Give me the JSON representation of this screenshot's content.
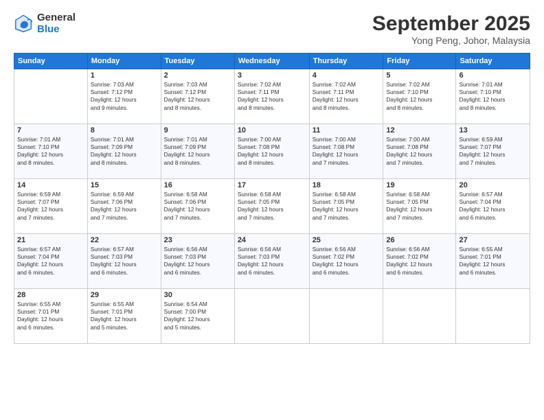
{
  "logo": {
    "general": "General",
    "blue": "Blue"
  },
  "title": "September 2025",
  "subtitle": "Yong Peng, Johor, Malaysia",
  "days_header": [
    "Sunday",
    "Monday",
    "Tuesday",
    "Wednesday",
    "Thursday",
    "Friday",
    "Saturday"
  ],
  "weeks": [
    [
      {
        "day": "",
        "info": ""
      },
      {
        "day": "1",
        "info": "Sunrise: 7:03 AM\nSunset: 7:12 PM\nDaylight: 12 hours\nand 9 minutes."
      },
      {
        "day": "2",
        "info": "Sunrise: 7:03 AM\nSunset: 7:12 PM\nDaylight: 12 hours\nand 8 minutes."
      },
      {
        "day": "3",
        "info": "Sunrise: 7:02 AM\nSunset: 7:11 PM\nDaylight: 12 hours\nand 8 minutes."
      },
      {
        "day": "4",
        "info": "Sunrise: 7:02 AM\nSunset: 7:11 PM\nDaylight: 12 hours\nand 8 minutes."
      },
      {
        "day": "5",
        "info": "Sunrise: 7:02 AM\nSunset: 7:10 PM\nDaylight: 12 hours\nand 8 minutes."
      },
      {
        "day": "6",
        "info": "Sunrise: 7:01 AM\nSunset: 7:10 PM\nDaylight: 12 hours\nand 8 minutes."
      }
    ],
    [
      {
        "day": "7",
        "info": "Sunrise: 7:01 AM\nSunset: 7:10 PM\nDaylight: 12 hours\nand 8 minutes."
      },
      {
        "day": "8",
        "info": "Sunrise: 7:01 AM\nSunset: 7:09 PM\nDaylight: 12 hours\nand 8 minutes."
      },
      {
        "day": "9",
        "info": "Sunrise: 7:01 AM\nSunset: 7:09 PM\nDaylight: 12 hours\nand 8 minutes."
      },
      {
        "day": "10",
        "info": "Sunrise: 7:00 AM\nSunset: 7:08 PM\nDaylight: 12 hours\nand 8 minutes."
      },
      {
        "day": "11",
        "info": "Sunrise: 7:00 AM\nSunset: 7:08 PM\nDaylight: 12 hours\nand 7 minutes."
      },
      {
        "day": "12",
        "info": "Sunrise: 7:00 AM\nSunset: 7:08 PM\nDaylight: 12 hours\nand 7 minutes."
      },
      {
        "day": "13",
        "info": "Sunrise: 6:59 AM\nSunset: 7:07 PM\nDaylight: 12 hours\nand 7 minutes."
      }
    ],
    [
      {
        "day": "14",
        "info": "Sunrise: 6:59 AM\nSunset: 7:07 PM\nDaylight: 12 hours\nand 7 minutes."
      },
      {
        "day": "15",
        "info": "Sunrise: 6:59 AM\nSunset: 7:06 PM\nDaylight: 12 hours\nand 7 minutes."
      },
      {
        "day": "16",
        "info": "Sunrise: 6:58 AM\nSunset: 7:06 PM\nDaylight: 12 hours\nand 7 minutes."
      },
      {
        "day": "17",
        "info": "Sunrise: 6:58 AM\nSunset: 7:05 PM\nDaylight: 12 hours\nand 7 minutes."
      },
      {
        "day": "18",
        "info": "Sunrise: 6:58 AM\nSunset: 7:05 PM\nDaylight: 12 hours\nand 7 minutes."
      },
      {
        "day": "19",
        "info": "Sunrise: 6:58 AM\nSunset: 7:05 PM\nDaylight: 12 hours\nand 7 minutes."
      },
      {
        "day": "20",
        "info": "Sunrise: 6:57 AM\nSunset: 7:04 PM\nDaylight: 12 hours\nand 6 minutes."
      }
    ],
    [
      {
        "day": "21",
        "info": "Sunrise: 6:57 AM\nSunset: 7:04 PM\nDaylight: 12 hours\nand 6 minutes."
      },
      {
        "day": "22",
        "info": "Sunrise: 6:57 AM\nSunset: 7:03 PM\nDaylight: 12 hours\nand 6 minutes."
      },
      {
        "day": "23",
        "info": "Sunrise: 6:56 AM\nSunset: 7:03 PM\nDaylight: 12 hours\nand 6 minutes."
      },
      {
        "day": "24",
        "info": "Sunrise: 6:56 AM\nSunset: 7:03 PM\nDaylight: 12 hours\nand 6 minutes."
      },
      {
        "day": "25",
        "info": "Sunrise: 6:56 AM\nSunset: 7:02 PM\nDaylight: 12 hours\nand 6 minutes."
      },
      {
        "day": "26",
        "info": "Sunrise: 6:56 AM\nSunset: 7:02 PM\nDaylight: 12 hours\nand 6 minutes."
      },
      {
        "day": "27",
        "info": "Sunrise: 6:55 AM\nSunset: 7:01 PM\nDaylight: 12 hours\nand 6 minutes."
      }
    ],
    [
      {
        "day": "28",
        "info": "Sunrise: 6:55 AM\nSunset: 7:01 PM\nDaylight: 12 hours\nand 6 minutes."
      },
      {
        "day": "29",
        "info": "Sunrise: 6:55 AM\nSunset: 7:01 PM\nDaylight: 12 hours\nand 5 minutes."
      },
      {
        "day": "30",
        "info": "Sunrise: 6:54 AM\nSunset: 7:00 PM\nDaylight: 12 hours\nand 5 minutes."
      },
      {
        "day": "",
        "info": ""
      },
      {
        "day": "",
        "info": ""
      },
      {
        "day": "",
        "info": ""
      },
      {
        "day": "",
        "info": ""
      }
    ]
  ]
}
